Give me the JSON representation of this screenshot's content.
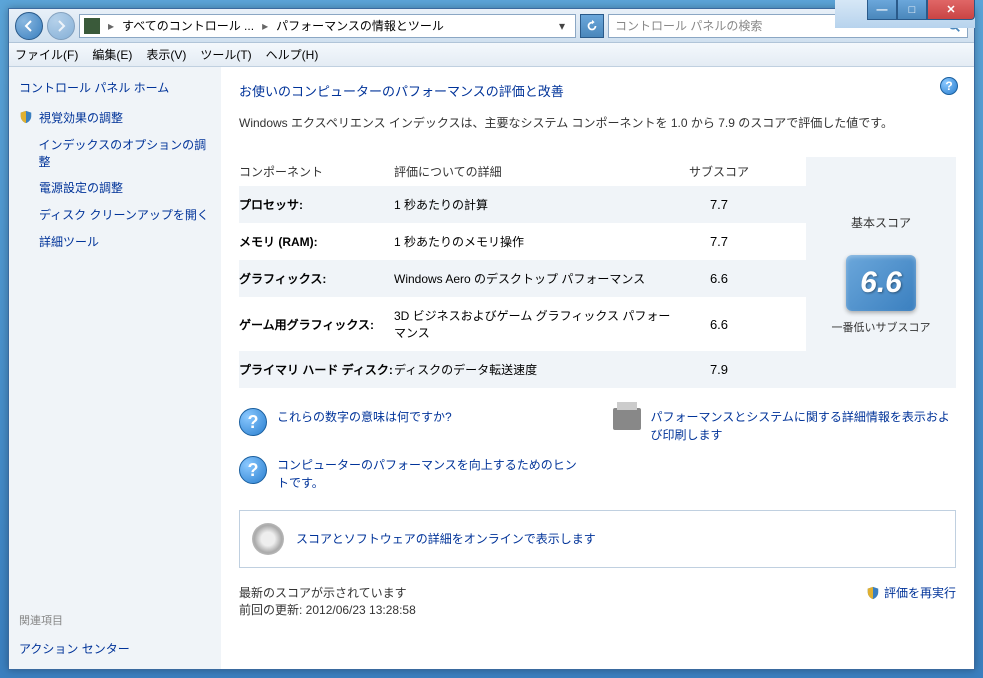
{
  "titlebar": {
    "min": "—",
    "max": "□",
    "close": "✕"
  },
  "addressbar": {
    "segment1": "すべてのコントロール ...",
    "segment2": "パフォーマンスの情報とツール",
    "search_placeholder": "コントロール パネルの検索"
  },
  "menu": {
    "file": "ファイル(F)",
    "edit": "編集(E)",
    "view": "表示(V)",
    "tools": "ツール(T)",
    "help": "ヘルプ(H)"
  },
  "sidebar": {
    "home": "コントロール パネル ホーム",
    "items": [
      "視覚効果の調整",
      "インデックスのオプションの調整",
      "電源設定の調整",
      "ディスク クリーンアップを開く",
      "詳細ツール"
    ],
    "related_heading": "関連項目",
    "related": "アクション センター"
  },
  "main": {
    "heading": "お使いのコンピューターのパフォーマンスの評価と改善",
    "desc": "Windows エクスペリエンス インデックスは、主要なシステム コンポーネントを 1.0 から 7.9 のスコアで評価した値です。",
    "headers": {
      "component": "コンポーネント",
      "detail": "評価についての詳細",
      "subscore": "サブスコア",
      "basescore": "基本スコア"
    },
    "rows": [
      {
        "comp": "プロセッサ:",
        "detail": "1 秒あたりの計算",
        "sub": "7.7"
      },
      {
        "comp": "メモリ (RAM):",
        "detail": "1 秒あたりのメモリ操作",
        "sub": "7.7"
      },
      {
        "comp": "グラフィックス:",
        "detail": "Windows Aero のデスクトップ パフォーマンス",
        "sub": "6.6"
      },
      {
        "comp": "ゲーム用グラフィックス:",
        "detail": "3D ビジネスおよびゲーム グラフィックス パフォーマンス",
        "sub": "6.6"
      },
      {
        "comp": "プライマリ ハード ディスク:",
        "detail": "ディスクのデータ転送速度",
        "sub": "7.9"
      }
    ],
    "bigscore": "6.6",
    "bigscore_label": "一番低いサブスコア",
    "link_meaning": "これらの数字の意味は何ですか?",
    "link_tips": "コンピューターのパフォーマンスを向上するためのヒントです。",
    "link_print": "パフォーマンスとシステムに関する詳細情報を表示および印刷します",
    "link_online": "スコアとソフトウェアの詳細をオンラインで表示します",
    "footer_status": "最新のスコアが示されています",
    "footer_updated": "前回の更新: 2012/06/23 13:28:58",
    "rerun": "評価を再実行"
  }
}
